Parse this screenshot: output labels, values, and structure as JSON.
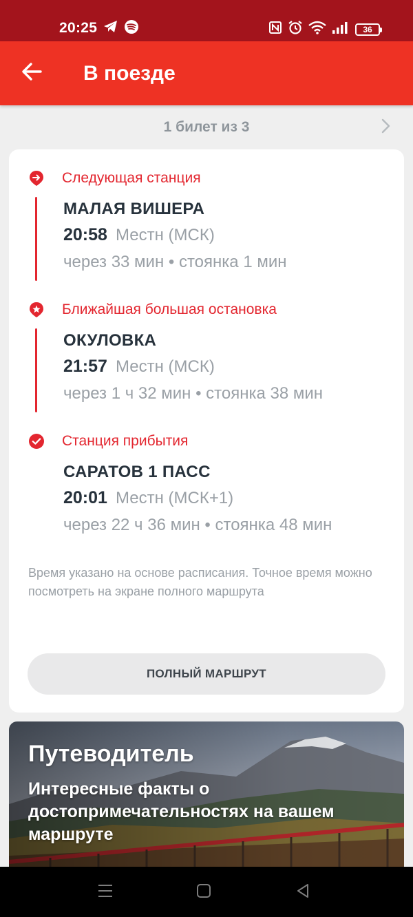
{
  "status_bar": {
    "time": "20:25",
    "battery": "36",
    "icons": [
      "telegram-icon",
      "spotify-icon",
      "nfc-icon",
      "alarm-icon",
      "wifi-icon",
      "signal-icon",
      "battery-icon"
    ]
  },
  "app_bar": {
    "title": "В поезде",
    "back_icon": "arrow-left-icon"
  },
  "pager": {
    "text": "1 билет из 3",
    "next_icon": "chevron-right-icon"
  },
  "stops": [
    {
      "header": "Следующая станция",
      "name": "МАЛАЯ ВИШЕРА",
      "time": "20:58",
      "timezone": "Местн (МСК)",
      "eta": "через 33 мин • стоянка 1 мин",
      "icon": "arrow-right-circle-icon"
    },
    {
      "header": "Ближайшая большая остановка",
      "name": "ОКУЛОВКА",
      "time": "21:57",
      "timezone": "Местн (МСК)",
      "eta": "через 1 ч 32 мин • стоянка 38 мин",
      "icon": "star-circle-icon"
    },
    {
      "header": "Станция прибытия",
      "name": "САРАТОВ 1 ПАСС",
      "time": "20:01",
      "timezone": "Местн (МСК+1)",
      "eta": "через 22 ч 36 мин • стоянка 48 мин",
      "icon": "check-circle-icon"
    }
  ],
  "note": "Время указано на основе расписания. Точное время можно посмотреть на экране полного маршрута",
  "route_button": "ПОЛНЫЙ МАРШРУТ",
  "guide": {
    "title": "Путеводитель",
    "subtitle": "Интересные факты о достопримечательностях на вашем маршруте"
  },
  "colors": {
    "status_bar": "#a3141c",
    "app_bar": "#ee3224",
    "accent": "#e3262f",
    "text_dark": "#27323c",
    "text_muted": "#9aa0a6"
  }
}
